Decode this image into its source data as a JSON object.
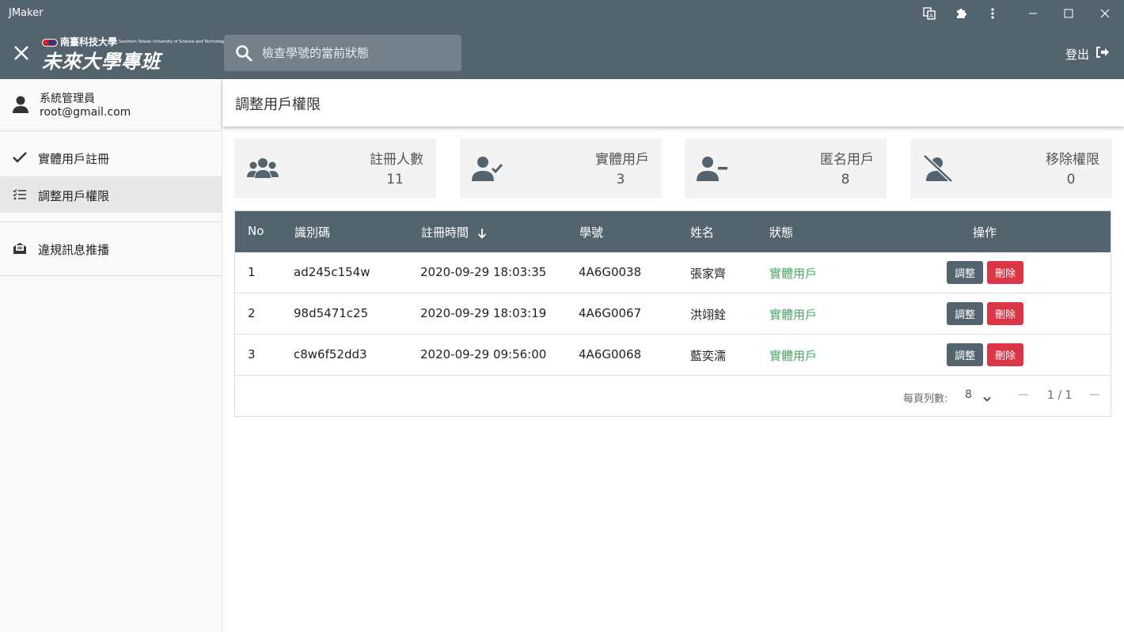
{
  "titlebar": {
    "app_title": "JMaker"
  },
  "header": {
    "logo": {
      "school_name": "南臺科技大學",
      "school_name_en": "Southern Taiwan University of Science and Technology",
      "program": "未來大學專班"
    },
    "search": {
      "placeholder": "檢查學號的當前狀態",
      "value": ""
    },
    "logout_label": "登出"
  },
  "sidebar": {
    "user": {
      "name": "系統管理員",
      "email": "root@gmail.com"
    },
    "items": [
      {
        "label": "實體用戶註冊",
        "icon": "check-icon",
        "active": false
      },
      {
        "label": "調整用戶權限",
        "icon": "checklist-icon",
        "active": true
      },
      {
        "label": "違規訊息推播",
        "icon": "mail-alert-icon",
        "active": false
      }
    ]
  },
  "page": {
    "title": "調整用戶權限"
  },
  "stats": [
    {
      "label": "註冊人數",
      "value": "11",
      "icon": "users-group-icon"
    },
    {
      "label": "實體用戶",
      "value": "3",
      "icon": "user-check-icon"
    },
    {
      "label": "匿名用戶",
      "value": "8",
      "icon": "user-minus-icon"
    },
    {
      "label": "移除權限",
      "value": "0",
      "icon": "user-slash-icon"
    }
  ],
  "table": {
    "headers": {
      "no": "No",
      "id": "識別碼",
      "time": "註冊時間",
      "student_id": "學號",
      "name": "姓名",
      "status": "狀態",
      "actions": "操作"
    },
    "rows": [
      {
        "no": "1",
        "id": "ad245c154w",
        "time": "2020-09-29 18:03:35",
        "student_id": "4A6G0038",
        "name": "張家齊",
        "status": "實體用戶"
      },
      {
        "no": "2",
        "id": "98d5471c25",
        "time": "2020-09-29 18:03:19",
        "student_id": "4A6G0067",
        "name": "洪翊銓",
        "status": "實體用戶"
      },
      {
        "no": "3",
        "id": "c8w6f52dd3",
        "time": "2020-09-29 09:56:00",
        "student_id": "4A6G0068",
        "name": "藍奕濡",
        "status": "實體用戶"
      }
    ],
    "adjust_label": "調整",
    "delete_label": "刪除"
  },
  "pagination": {
    "rows_per_page_label": "每頁列數:",
    "rows_per_page": "8",
    "page_info": "1 / 1"
  },
  "colors": {
    "primary": "#54646f",
    "danger": "#dc3545",
    "success": "#4aa564"
  }
}
